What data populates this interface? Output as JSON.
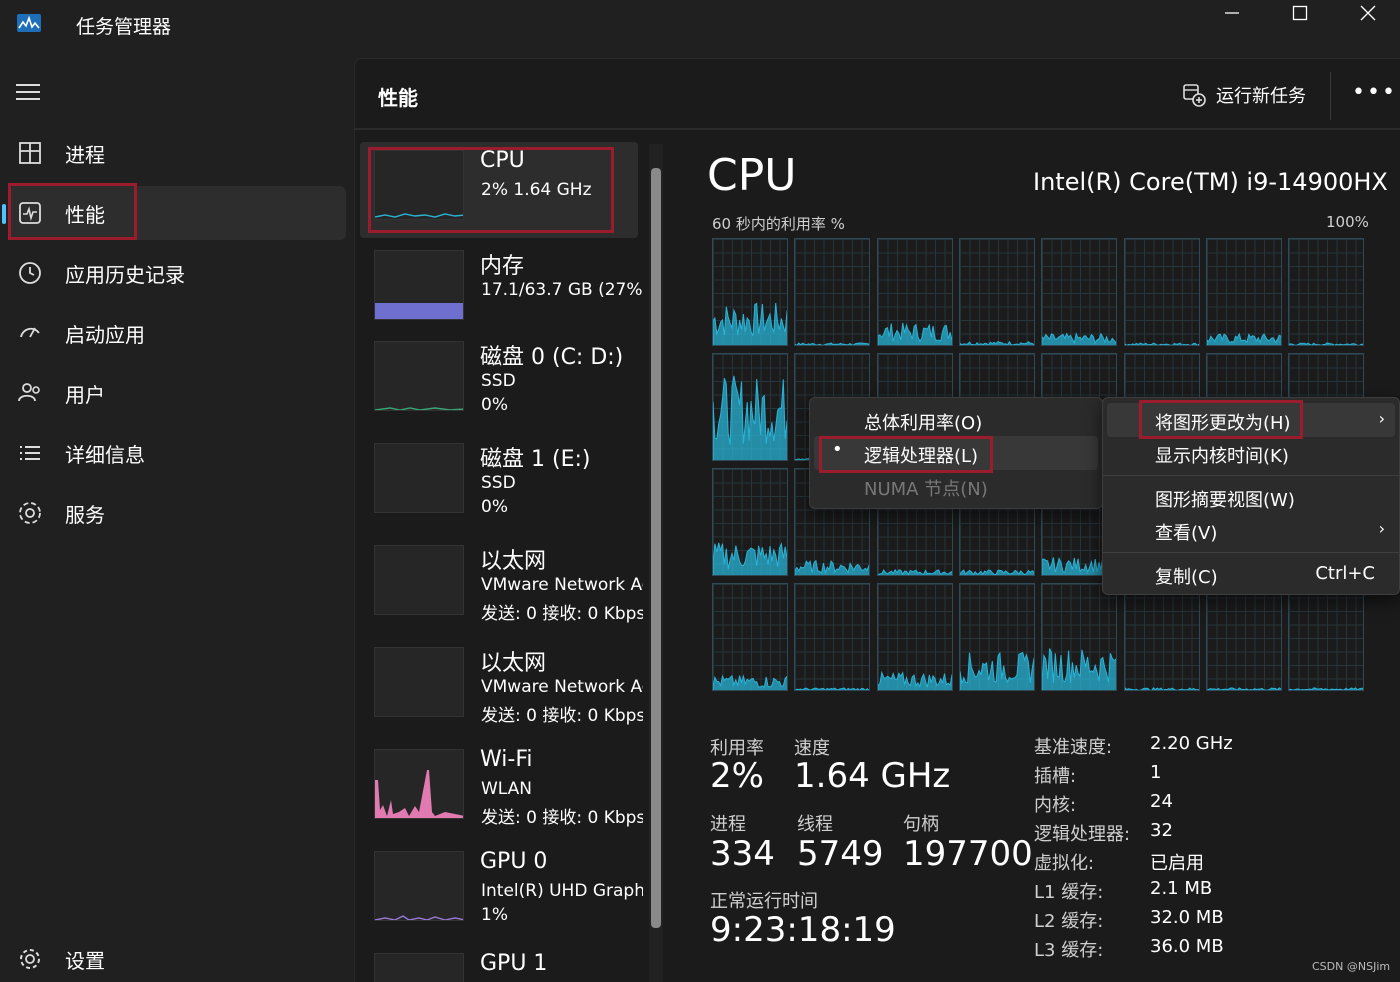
{
  "app": {
    "title": "任务管理器"
  },
  "nav": {
    "items": [
      {
        "label": "进程",
        "icon": "processes-icon"
      },
      {
        "label": "性能",
        "icon": "performance-icon"
      },
      {
        "label": "应用历史记录",
        "icon": "history-icon"
      },
      {
        "label": "启动应用",
        "icon": "startup-icon"
      },
      {
        "label": "用户",
        "icon": "users-icon"
      },
      {
        "label": "详细信息",
        "icon": "details-icon"
      },
      {
        "label": "服务",
        "icon": "services-icon"
      }
    ],
    "settings": "设置"
  },
  "header": {
    "title": "性能",
    "run_task": "运行新任务"
  },
  "devices": [
    {
      "name": "CPU",
      "line1": "2%  1.64 GHz",
      "line2": ""
    },
    {
      "name": "内存",
      "line1": "17.1/63.7 GB (27%)",
      "line2": ""
    },
    {
      "name": "磁盘 0 (C: D:)",
      "line1": "SSD",
      "line2": "0%"
    },
    {
      "name": "磁盘 1 (E:)",
      "line1": "SSD",
      "line2": "0%"
    },
    {
      "name": "以太网",
      "line1": "VMware Network Adapter",
      "line2": "发送: 0  接收: 0 Kbps"
    },
    {
      "name": "以太网",
      "line1": "VMware Network Adapter",
      "line2": "发送: 0  接收: 0 Kbps"
    },
    {
      "name": "Wi-Fi",
      "line1": "WLAN",
      "line2": "发送: 0  接收: 0 Kbps"
    },
    {
      "name": "GPU 0",
      "line1": "Intel(R) UHD Graphics",
      "line2": "1%"
    },
    {
      "name": "GPU 1",
      "line1": "",
      "line2": ""
    }
  ],
  "cpu": {
    "title": "CPU",
    "model": "Intel(R) Core(TM) i9-14900HX",
    "util_label": "60 秒内的利用率 %",
    "util_max": "100%",
    "stats": {
      "util_label": "利用率",
      "util_value": "2%",
      "speed_label": "速度",
      "speed_value": "1.64 GHz",
      "proc_label": "进程",
      "proc_value": "334",
      "thread_label": "线程",
      "thread_value": "5749",
      "handle_label": "句柄",
      "handle_value": "197700",
      "uptime_label": "正常运行时间",
      "uptime_value": "9:23:18:19"
    },
    "details": [
      {
        "k": "基准速度:",
        "v": "2.20 GHz"
      },
      {
        "k": "插槽:",
        "v": "1"
      },
      {
        "k": "内核:",
        "v": "24"
      },
      {
        "k": "逻辑处理器:",
        "v": "32"
      },
      {
        "k": "虚拟化:",
        "v": "已启用"
      },
      {
        "k": "L1 缓存:",
        "v": "2.1 MB"
      },
      {
        "k": "L2 缓存:",
        "v": "32.0 MB"
      },
      {
        "k": "L3 缓存:",
        "v": "36.0 MB"
      }
    ]
  },
  "submenu": {
    "overall": "总体利用率(O)",
    "logical": "逻辑处理器(L)",
    "numa": "NUMA 节点(N)"
  },
  "context_menu": {
    "change_graph": "将图形更改为(H)",
    "kernel_times": "显示内核时间(K)",
    "summary_view": "图形摘要视图(W)",
    "view": "查看(V)",
    "copy": "复制(C)",
    "copy_shortcut": "Ctrl+C"
  },
  "colors": {
    "accent": "#4cc2ff",
    "cpu_graph": "#2ab3d6",
    "memory": "#6f6fd0",
    "disk": "#3aa776",
    "wifi": "#e07ab0",
    "highlight_box": "#9b1c2c"
  },
  "watermark": "CSDN @NSJim"
}
